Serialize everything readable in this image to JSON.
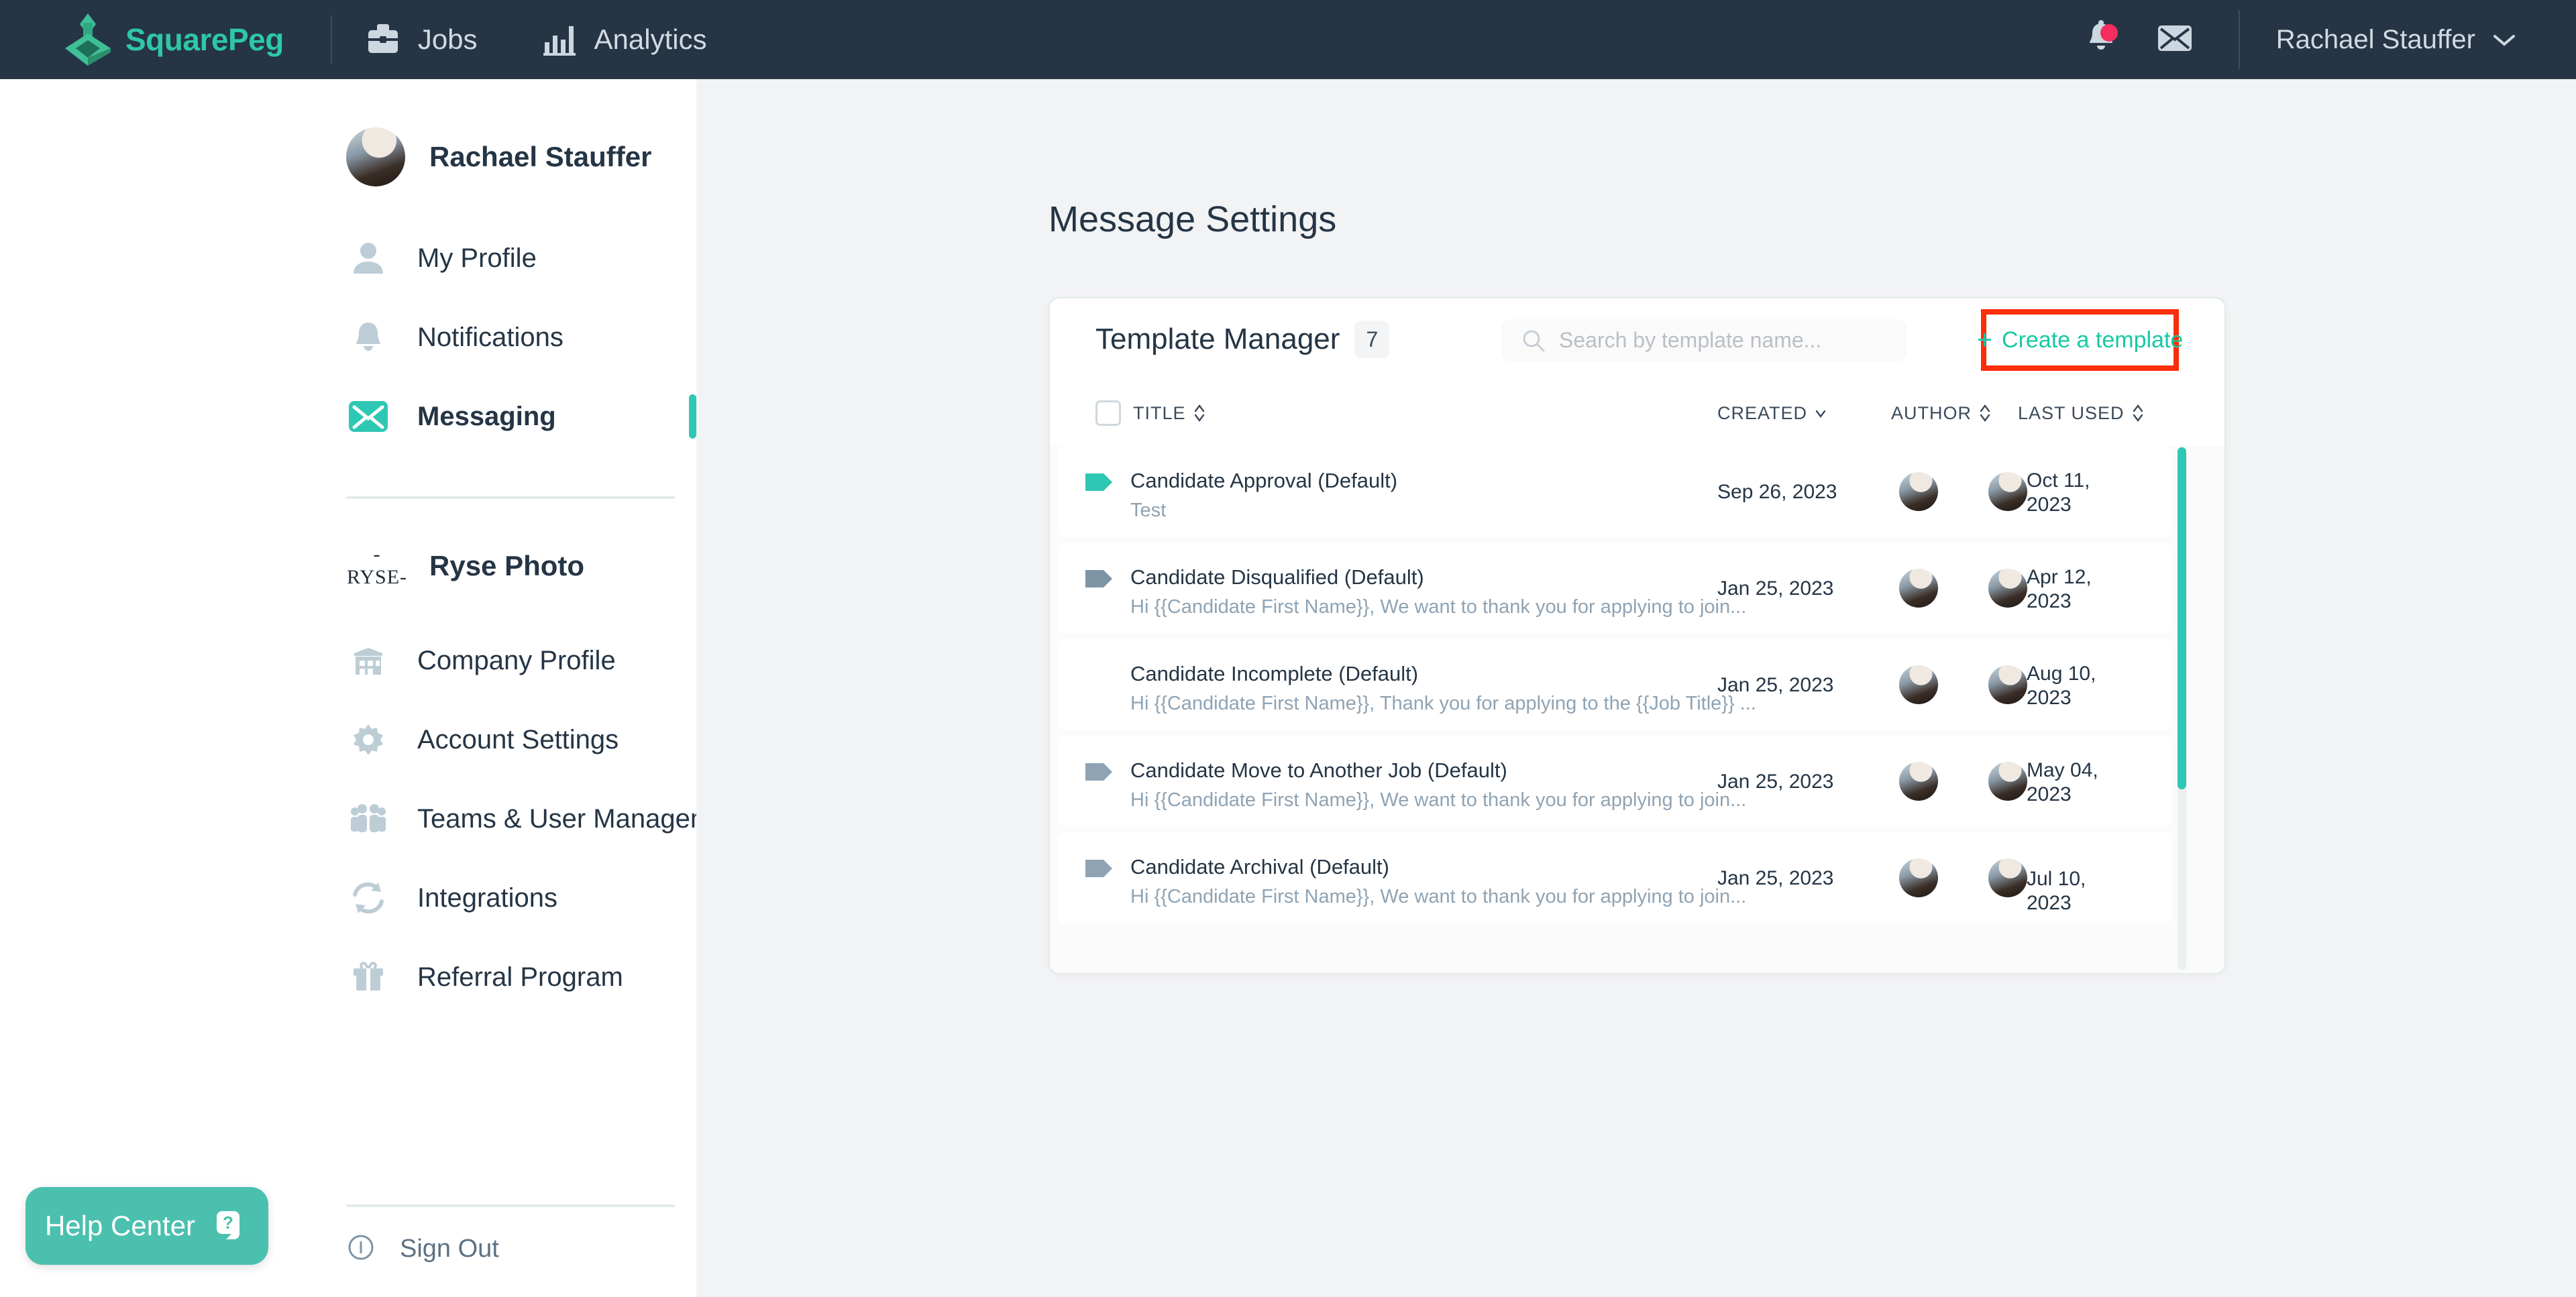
{
  "topbar": {
    "brand_name": "SquarePeg",
    "brand_color": "#2ec7a7",
    "background": "#253545",
    "nav": [
      {
        "label": "Jobs",
        "icon": "briefcase-icon"
      },
      {
        "label": "Analytics",
        "icon": "bar-chart-icon"
      }
    ],
    "notifications_icon": "bell-icon",
    "has_notification_badge": true,
    "messages_icon": "envelope-icon",
    "user_name": "Rachael Stauffer",
    "caret_icon": "chevron-down-icon"
  },
  "sidebar": {
    "profile_name": "Rachael Stauffer",
    "items": [
      {
        "label": "My Profile",
        "icon": "user-icon",
        "active": false
      },
      {
        "label": "Notifications",
        "icon": "bell-icon",
        "active": false
      },
      {
        "label": "Messaging",
        "icon": "envelope-icon",
        "active": true
      }
    ],
    "company_logo_text": "-RYSE-",
    "company_name": "Ryse Photo",
    "company_items": [
      {
        "label": "Company Profile",
        "icon": "building-icon"
      },
      {
        "label": "Account Settings",
        "icon": "gear-icon"
      },
      {
        "label": "Teams & User Management",
        "icon": "people-icon"
      },
      {
        "label": "Integrations",
        "icon": "sync-icon"
      },
      {
        "label": "Referral Program",
        "icon": "gift-icon"
      }
    ],
    "sign_out_label": "Sign Out",
    "sign_out_icon": "info-circle-icon",
    "help_center_label": "Help Center",
    "help_center_icon": "question-chat-icon",
    "help_center_color": "#4bc0ae",
    "active_indicator_color": "#2ec7b4"
  },
  "main": {
    "page_title": "Message Settings",
    "card": {
      "title": "Template Manager",
      "count": "7",
      "search": {
        "placeholder": "Search by template name...",
        "icon": "search-icon",
        "value": ""
      },
      "create_button": {
        "label": "Create a template",
        "plus_icon": "plus-icon",
        "text_color": "#17c9a4",
        "highlight_color": "#fb2e0a"
      },
      "table": {
        "select_all_checkbox": false,
        "columns": [
          {
            "label": "TITLE",
            "sort": "updown"
          },
          {
            "label": "CREATED",
            "sort": "down"
          },
          {
            "label": "AUTHOR",
            "sort": "updown"
          },
          {
            "label": "LAST USED",
            "sort": "updown"
          }
        ],
        "rows": [
          {
            "tag_color": "#2ec7b4",
            "has_tag": true,
            "title": "Candidate Approval (Default)",
            "preview": "Test",
            "created": "Sep 26, 2023",
            "last_used": "Oct 11, 2023"
          },
          {
            "tag_color": "#7d94a5",
            "has_tag": true,
            "title": "Candidate Disqualified (Default)",
            "preview": "Hi {{Candidate First Name}}, We want to thank you for applying to join...",
            "created": "Jan 25, 2023",
            "last_used": "Apr 12, 2023"
          },
          {
            "tag_color": "",
            "has_tag": false,
            "title": "Candidate Incomplete (Default)",
            "preview": "Hi {{Candidate First Name}}, Thank you for applying to the {{Job Title}} ...",
            "created": "Jan 25, 2023",
            "last_used": "Aug 10, 2023"
          },
          {
            "tag_color": "#8fa3b3",
            "has_tag": true,
            "title": "Candidate Move to Another Job (Default)",
            "preview": "Hi {{Candidate First Name}}, We want to thank you for applying to join...",
            "created": "Jan 25, 2023",
            "last_used": "May 04, 2023"
          },
          {
            "tag_color": "#8fa3b3",
            "has_tag": true,
            "title": "Candidate Archival (Default)",
            "preview": "Hi {{Candidate First Name}}, We want to thank you for applying to join...",
            "created": "Jan 25, 2023",
            "last_used": "Jul 10, 2023"
          }
        ]
      }
    }
  }
}
